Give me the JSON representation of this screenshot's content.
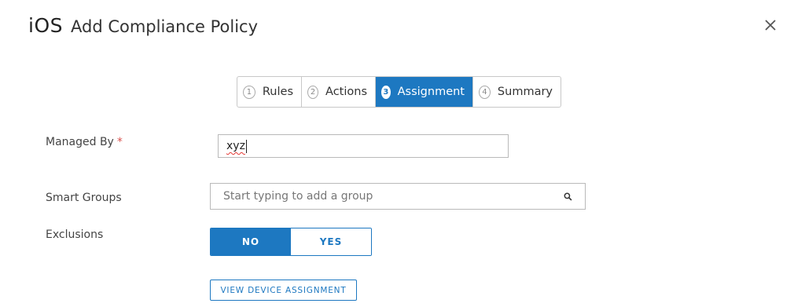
{
  "header": {
    "os_label": "iOS",
    "title": "Add Compliance Policy",
    "close_icon": "close-icon"
  },
  "wizard": {
    "steps": [
      {
        "number": "1",
        "label": "Rules"
      },
      {
        "number": "2",
        "label": "Actions"
      },
      {
        "number": "3",
        "label": "Assignment"
      },
      {
        "number": "4",
        "label": "Summary"
      }
    ],
    "active_step": "Assignment"
  },
  "form": {
    "managed_by": {
      "label": "Managed By",
      "required_marker": "*",
      "value": "xyz"
    },
    "smart_groups": {
      "label": "Smart Groups",
      "placeholder": "Start typing to add a group",
      "icon": "search-icon"
    },
    "exclusions": {
      "label": "Exclusions",
      "options": [
        "NO",
        "YES"
      ],
      "selected": "NO"
    },
    "view_device_assignment": "VIEW DEVICE ASSIGNMENT"
  },
  "colors": {
    "accent": "#1d78c1",
    "required": "#d9534f"
  }
}
